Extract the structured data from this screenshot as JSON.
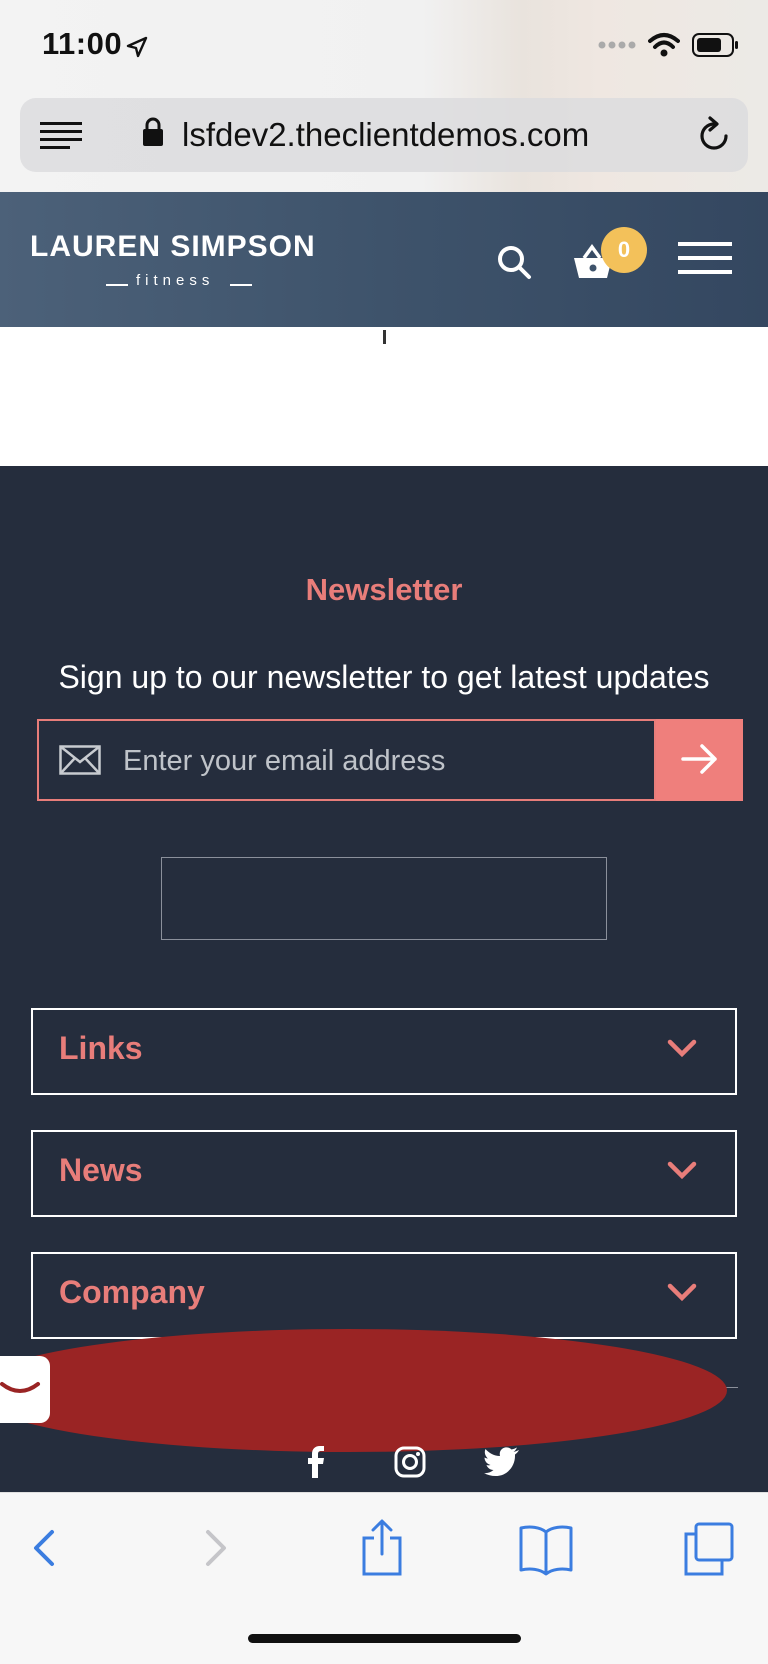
{
  "status_bar": {
    "time": "11:00"
  },
  "browser": {
    "url": "lsfdev2.theclientdemos.com"
  },
  "header": {
    "brand_name": "LAUREN SIMPSON",
    "brand_sub": "fitness",
    "cart_count": "0"
  },
  "newsletter": {
    "title": "Newsletter",
    "description": "Sign up to our newsletter to get latest updates",
    "email_placeholder": "Enter your email address"
  },
  "accordions": [
    {
      "label": "Links"
    },
    {
      "label": "News"
    },
    {
      "label": "Company"
    }
  ],
  "colors": {
    "accent": "#e87d7a",
    "footer_bg": "#252d3d",
    "header_bg": "#3e536b",
    "badge": "#f3c15a",
    "safari_blue": "#3b7de0"
  }
}
